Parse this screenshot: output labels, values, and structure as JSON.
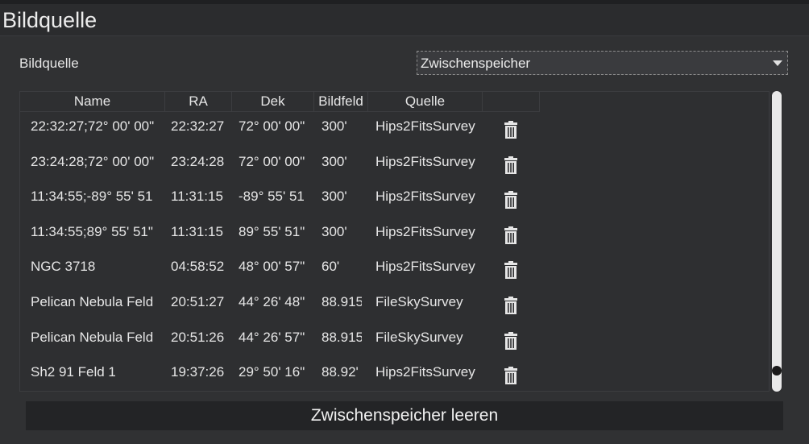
{
  "header": {
    "title": "Bildquelle"
  },
  "source": {
    "label": "Bildquelle",
    "selected": "Zwischenspeicher"
  },
  "table": {
    "columns": [
      "Name",
      "RA",
      "Dek",
      "Bildfeld",
      "Quelle"
    ],
    "rows": [
      {
        "name": "22:32:27;72° 00' 00\"",
        "ra": "22:32:27",
        "dek": "72° 00' 00\"",
        "bildfeld": "300'",
        "quelle": "Hips2FitsSurvey"
      },
      {
        "name": "23:24:28;72° 00' 00\"",
        "ra": "23:24:28",
        "dek": "72° 00' 00\"",
        "bildfeld": "300'",
        "quelle": "Hips2FitsSurvey"
      },
      {
        "name": "11:34:55;-89° 55' 51",
        "ra": "11:31:15",
        "dek": "-89° 55' 51",
        "bildfeld": "300'",
        "quelle": "Hips2FitsSurvey"
      },
      {
        "name": "11:34:55;89° 55' 51\"",
        "ra": "11:31:15",
        "dek": "89° 55' 51\"",
        "bildfeld": "300'",
        "quelle": "Hips2FitsSurvey"
      },
      {
        "name": "NGC 3718",
        "ra": "04:58:52",
        "dek": "48° 00' 57\"",
        "bildfeld": "60'",
        "quelle": "Hips2FitsSurvey"
      },
      {
        "name": "Pelican Nebula Feld",
        "ra": "20:51:27",
        "dek": "44° 26' 48\"",
        "bildfeld": "88.915",
        "quelle": "FileSkySurvey"
      },
      {
        "name": "Pelican Nebula Feld",
        "ra": "20:51:26",
        "dek": "44° 26' 57\"",
        "bildfeld": "88.915",
        "quelle": "FileSkySurvey"
      },
      {
        "name": "Sh2 91 Feld 1",
        "ra": "19:37:26",
        "dek": "29° 50' 16\"",
        "bildfeld": "88.92'",
        "quelle": "Hips2FitsSurvey"
      }
    ],
    "row_action_icon": "trash-icon"
  },
  "actions": {
    "clear_label": "Zwischenspeicher leeren"
  },
  "colors": {
    "background": "#303133",
    "header": "#2b2c2e",
    "button": "#232426",
    "text": "#e6e6e6"
  }
}
